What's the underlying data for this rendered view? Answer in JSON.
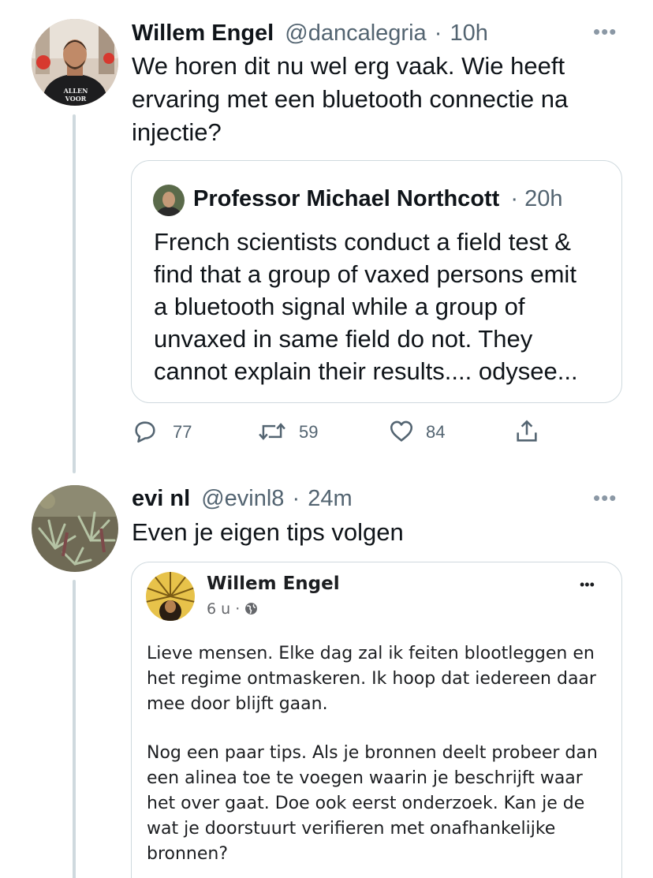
{
  "tweet1": {
    "author_name": "Willem Engel",
    "handle": "@dancalegria",
    "separator": "·",
    "time": "10h",
    "more_icon": "more-horizontal-icon",
    "lines": [
      "We horen dit nu wel erg vaak. Wie heeft",
      "ervaring met een bluetooth connectie na",
      "injectie?"
    ],
    "avatar_caption": "ALLEN VOOR",
    "quote": {
      "author_name": "Professor Michael Northcott",
      "separator": "·",
      "time": "20h",
      "lines": [
        "French scientists conduct a field test &",
        "find that a group of vaxed persons emit",
        "a bluetooth signal while a group of",
        "unvaxed in same field do not. They",
        "cannot explain their results.... odysee..."
      ]
    },
    "actions": {
      "reply_count": "77",
      "retweet_count": "59",
      "like_count": "84"
    }
  },
  "tweet2": {
    "author_name": "evi nl",
    "handle": "@evinl8",
    "separator": "·",
    "time": "24m",
    "text": "Even je eigen tips volgen",
    "fb_post": {
      "author_name": "Willem Engel",
      "time": "6 u",
      "separator": "·",
      "audience_icon": "globe-icon",
      "more_icon": "more-horizontal-icon",
      "paragraph1": [
        "Lieve mensen. Elke dag zal ik feiten blootleggen en",
        "het regime ontmaskeren. Ik hoop dat iedereen daar",
        "mee door blijft gaan."
      ],
      "paragraph2": [
        "Nog een paar tips. Als je bronnen deelt probeer dan",
        "een alinea toe te voegen waarin je beschrijft waar",
        "het over gaat. Doe ook eerst onderzoek. Kan je de",
        "wat je doorstuurt verifieren met onafhankelijke",
        "bronnen?"
      ]
    }
  },
  "colors": {
    "text": "#0f1419",
    "muted": "#536471",
    "border": "#cfd9de"
  }
}
